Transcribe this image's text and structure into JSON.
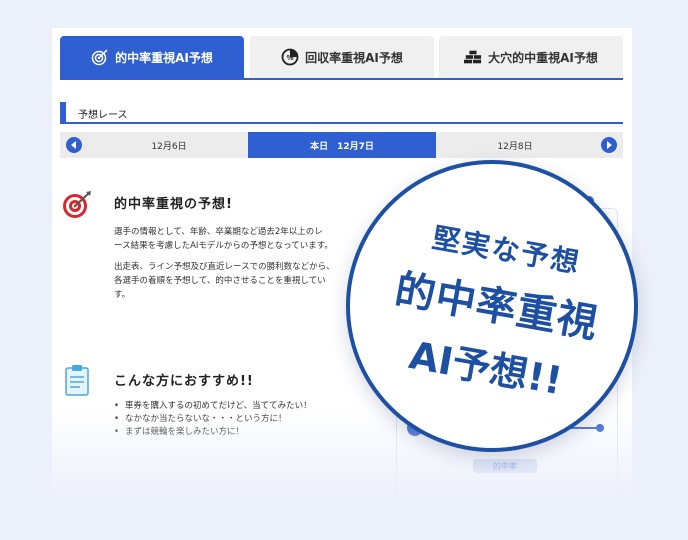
{
  "tabs": [
    {
      "label": "的中率重視AI予想",
      "icon": "target-icon"
    },
    {
      "label": "回収率重視AI予想",
      "icon": "percent-pie-icon"
    },
    {
      "label": "大穴的中重視AI予想",
      "icon": "gold-bars-icon"
    }
  ],
  "race_section": {
    "label": "予想レース"
  },
  "date_nav": {
    "prev_date": "12月6日",
    "today": "本日　12月7日",
    "next_date": "12月8日"
  },
  "prediction": {
    "title": "的中率重視の予想!",
    "paragraph1": [
      "選手の情報として、年齢、卒業期など過去2年以上のレ",
      "ース結果を考慮したAIモデルからの予想となっています。"
    ],
    "paragraph2": [
      "出走表、ライン予想及び直近レースでの勝利数などから、",
      "各選手の着順を予想して、的中させることを重視してい",
      "す。"
    ]
  },
  "recommend": {
    "title": "こんな方におすすめ!!",
    "items": [
      "車券を購入するの初めてだけど、当ててみたい！",
      "なかなか当たらないな・・・という方に！",
      "まずは競輪を楽しみたい方に！"
    ]
  },
  "chart_pill": "的中率",
  "stamp": {
    "line1": "堅実な予想",
    "line2": "的中率重視",
    "line3": "AI予想!!"
  },
  "colors": {
    "accent": "#2f5fd0",
    "stamp": "#1d4fa3"
  }
}
